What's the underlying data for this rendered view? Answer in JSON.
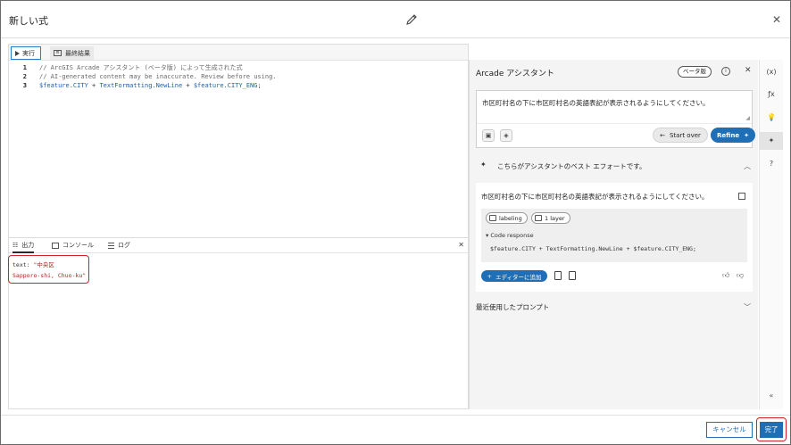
{
  "header": {
    "title": "新しい式"
  },
  "editor": {
    "run_label": "実行",
    "result_label": "最終結果",
    "lines": [
      {
        "num": "1",
        "text": "// ArcGIS Arcade アシスタント (ベータ版) によって生成された式"
      },
      {
        "num": "2",
        "text": "// AI-generated content may be inaccurate. Review before using."
      },
      {
        "num": "3",
        "code_parts": [
          "$feature.CITY",
          " + ",
          "TextFormatting.NewLine",
          " + ",
          "$feature.CITY_ENG",
          ";"
        ]
      }
    ]
  },
  "output_panel": {
    "tabs": [
      "出力",
      "コンソール",
      "ログ"
    ],
    "output_key": "text: ",
    "output_value_line1": "\"中央区",
    "output_value_line2": "Sapporo-shi, Chuo-ku\""
  },
  "assistant": {
    "title": "Arcade アシスタント",
    "beta_badge": "ベータ版",
    "prompt_text": "市区町村名の下に市区町村名の英語表記が表示されるようにしてください。",
    "start_over_label": "Start over",
    "refine_label": "Refine",
    "best_effort_text": "こちらがアシスタントのベスト エフォートです。",
    "response_text": "市区町村名の下に市区町村名の英語表記が表示されるようにしてください。",
    "chips": [
      "labeling",
      "1 layer"
    ],
    "code_response_label": "Code response",
    "code_response": "$feature.CITY + TextFormatting.NewLine + $feature.CITY_ENG;",
    "add_to_editor_label": "エディターに追加",
    "recent_prompts_label": "最近使用したプロンプト"
  },
  "rail": {
    "icons": [
      "(x)",
      "ƒx",
      "💡",
      "✦",
      "?"
    ],
    "collapse": "«"
  },
  "footer": {
    "cancel_label": "キャンセル",
    "done_label": "完了"
  }
}
